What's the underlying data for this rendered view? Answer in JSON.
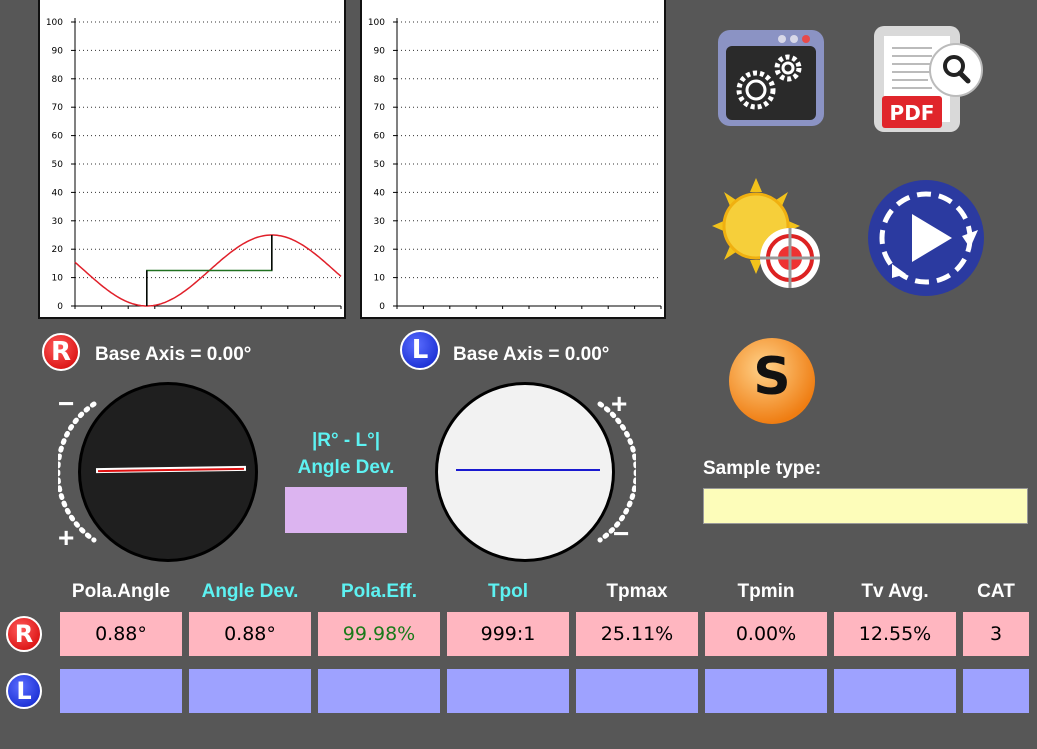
{
  "charts": {
    "y_ticks": [
      "100",
      "90",
      "80",
      "70",
      "60",
      "50",
      "40",
      "30",
      "20",
      "10",
      "0"
    ]
  },
  "chart_data": [
    {
      "type": "line",
      "title": "",
      "xlabel": "",
      "ylabel": "",
      "ylim": [
        0,
        100
      ],
      "grid": true,
      "series": [
        {
          "color": "#e0202a",
          "shape": "sine",
          "values_approx": {
            "start": 18,
            "min": 0,
            "max": 25,
            "end": 9
          }
        },
        {
          "color": "#207020",
          "shape": "step",
          "values_approx": {
            "low": 0,
            "plateau": 12.5,
            "high": 25
          }
        }
      ]
    },
    {
      "type": "line",
      "title": "",
      "xlabel": "",
      "ylabel": "",
      "ylim": [
        0,
        100
      ],
      "grid": true,
      "series": []
    }
  ],
  "right_side": {
    "badge": "R",
    "base_axis": "Base Axis = 0.00°",
    "minus": "−",
    "plus": "+"
  },
  "left_side": {
    "badge": "L",
    "base_axis": "Base Axis = 0.00°",
    "minus": "−",
    "plus": "+"
  },
  "angle_dev_box": {
    "line1": "|R° - L°|",
    "line2": "Angle Dev.",
    "value": "",
    "bg": "#dcb4f0"
  },
  "sample": {
    "label": "Sample type:",
    "value": "",
    "bg": "#fdfdba"
  },
  "icons": [
    "settings-gears-icon",
    "pdf-search-icon",
    "sun-target-icon",
    "play-refresh-icon",
    "s-button-icon"
  ],
  "s_button_label": "S",
  "table": {
    "headers": [
      {
        "label": "Pola.Angle",
        "color": "#ffffff"
      },
      {
        "label": "Angle Dev.",
        "color": "#5df2f2"
      },
      {
        "label": "Pola.Eff.",
        "color": "#5df2f2"
      },
      {
        "label": "Tpol",
        "color": "#5df2f2"
      },
      {
        "label": "Tpmax",
        "color": "#ffffff"
      },
      {
        "label": "Tpmin",
        "color": "#ffffff"
      },
      {
        "label": "Tv Avg.",
        "color": "#ffffff"
      },
      {
        "label": "CAT",
        "color": "#ffffff"
      }
    ],
    "rows": [
      {
        "badge": "R",
        "values": [
          "0.88°",
          "0.88°",
          "99.98%",
          "999:1",
          "25.11%",
          "0.00%",
          "12.55%",
          "3"
        ]
      },
      {
        "badge": "L",
        "values": [
          "",
          "",
          "",
          "",
          "",
          "",
          "",
          ""
        ]
      }
    ],
    "highlight_color": "#1a7a1a"
  }
}
